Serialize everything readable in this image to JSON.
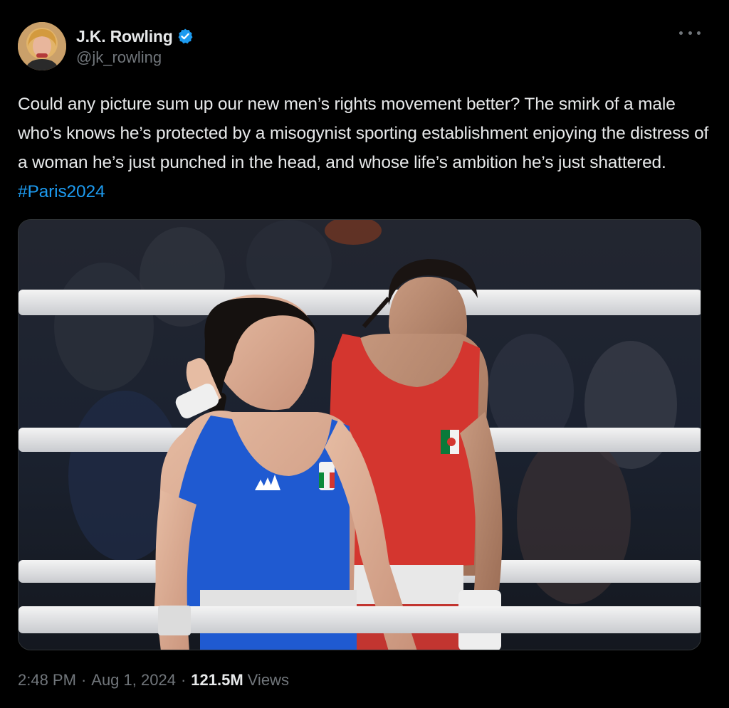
{
  "author": {
    "display_name": "J.K. Rowling",
    "handle": "@jk_rowling",
    "verified": true,
    "avatar_icon": "profile-photo"
  },
  "tweet": {
    "text": "Could any picture sum up our new men’s rights movement better? The smirk of a male who’s knows he’s protected by a misogynist sporting establishment enjoying the distress of a woman he’s just punched in the head, and whose life’s ambition he’s just shattered.",
    "hashtag": "#Paris2024"
  },
  "media": {
    "icon": "boxing-photo"
  },
  "meta": {
    "time": "2:48 PM",
    "separator": "·",
    "date": "Aug 1, 2024",
    "views_count": "121.5M",
    "views_label": "Views"
  },
  "colors": {
    "background": "#000000",
    "text": "#e7e9ea",
    "secondary": "#71767b",
    "link": "#1d9bf0",
    "verified": "#1d9bf0"
  }
}
